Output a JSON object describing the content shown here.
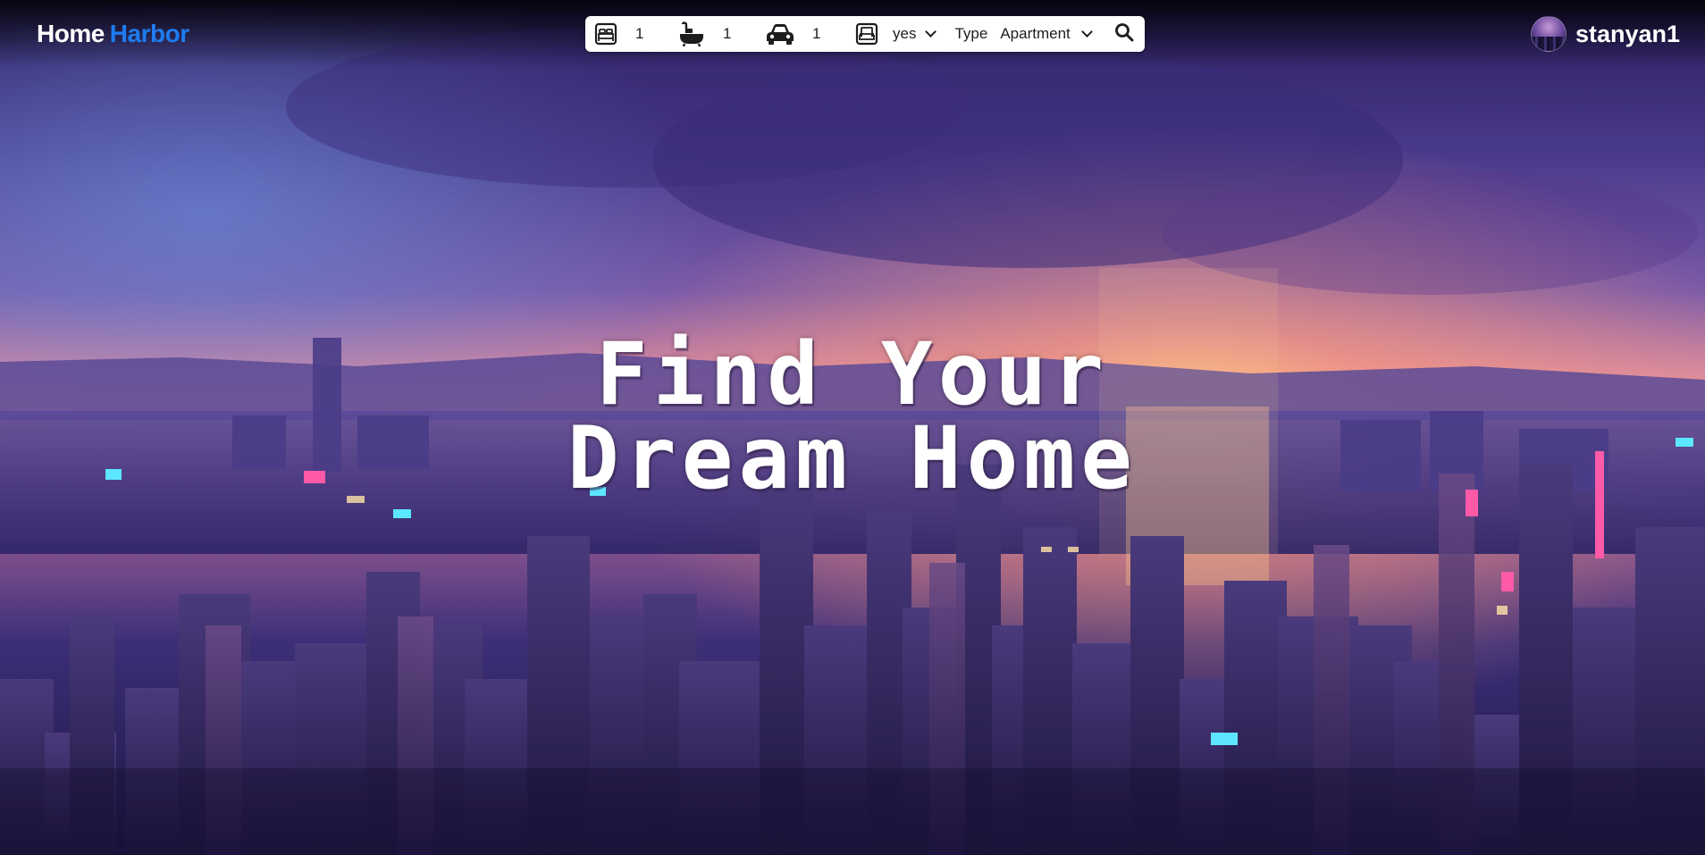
{
  "brand": {
    "part1": "Home",
    "part2": "Harbor"
  },
  "search": {
    "bedrooms": {
      "icon": "bed-icon",
      "value": "1"
    },
    "bathrooms": {
      "icon": "bath-icon",
      "value": "1"
    },
    "parking": {
      "icon": "car-icon",
      "value": "1"
    },
    "furnished": {
      "icon": "furnished-icon",
      "value": "yes"
    },
    "type_label": "Type",
    "type_value": "Apartment",
    "search_icon": "search-icon"
  },
  "user": {
    "username": "stanyan1",
    "avatar_icon": "avatar"
  },
  "hero": {
    "line1": "Find Your",
    "line2": "Dream Home"
  },
  "colors": {
    "brand_accent": "#1e7cf0",
    "text_white": "#ffffff"
  }
}
